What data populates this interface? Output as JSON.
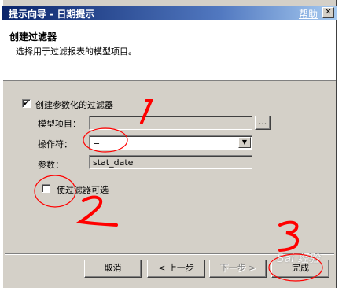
{
  "window": {
    "title": "提示向导 - 日期提示",
    "help_link": "帮助",
    "close_glyph": "✕"
  },
  "header": {
    "title": "创建过滤器",
    "subtitle": "选择用于过滤报表的模型项目。"
  },
  "form": {
    "create_param_filter": {
      "label": "创建参数化的过滤器",
      "checked": true
    },
    "model_item": {
      "label": "模型项目：",
      "value": "",
      "browse_label": "..."
    },
    "operator": {
      "label": "操作符：",
      "value": "=",
      "dropdown_glyph": "▼"
    },
    "param": {
      "label": "参数：",
      "value": "stat_date"
    },
    "optional_filter": {
      "label": "使过滤器可选",
      "checked": false
    }
  },
  "buttons": {
    "cancel": "取消",
    "back": "< 上一步",
    "next": "下一步 >",
    "finish": "完成"
  },
  "annotations": {
    "mark1": "1",
    "mark2": "2",
    "mark3": "3",
    "color": "#ff0000"
  },
  "watermark": {
    "text": "Bai 经验"
  }
}
